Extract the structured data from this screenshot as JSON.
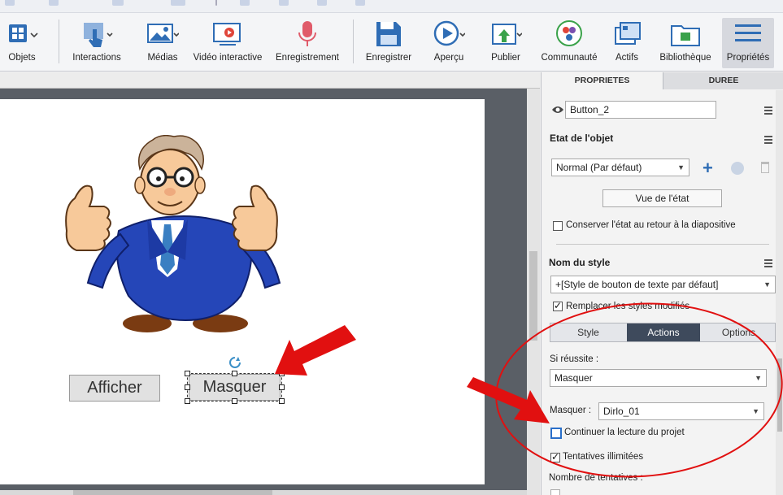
{
  "toolbar": {
    "items": [
      {
        "label": "Objets",
        "icon": "objects-grid-icon"
      },
      {
        "label": "Interactions",
        "icon": "hand-pointer-icon"
      },
      {
        "label": "Médias",
        "icon": "image-icon"
      },
      {
        "label": "Vidéo interactive",
        "icon": "interactive-video-icon"
      },
      {
        "label": "Enregistrement",
        "icon": "microphone-icon"
      },
      {
        "label": "Enregistrer",
        "icon": "save-disk-icon"
      },
      {
        "label": "Aperçu",
        "icon": "play-preview-icon"
      },
      {
        "label": "Publier",
        "icon": "publish-icon"
      },
      {
        "label": "Communauté",
        "icon": "community-icon"
      },
      {
        "label": "Actifs",
        "icon": "assets-icon"
      },
      {
        "label": "Bibliothèque",
        "icon": "library-folder-icon"
      },
      {
        "label": "Propriétés",
        "icon": "properties-list-icon"
      }
    ]
  },
  "stage": {
    "button_show": "Afficher",
    "button_hide": "Masquer"
  },
  "panel": {
    "tab_properties": "PROPRIETES",
    "tab_duration": "DUREE",
    "object_name": "Button_2",
    "state_heading": "Etat de l'objet",
    "state_value": "Normal (Par défaut)",
    "state_view_button": "Vue de l'état",
    "keep_state_label": "Conserver l'état au retour à la diapositive",
    "style_heading": "Nom du style",
    "style_value": "+[Style de bouton de texte par défaut]",
    "replace_styles_label": "Remplacer les styles modifiés",
    "seg_style": "Style",
    "seg_actions": "Actions",
    "seg_options": "Options",
    "success_label": "Si réussite :",
    "success_value": "Masquer",
    "hide_label": "Masquer :",
    "hide_value": "Dirlo_01",
    "continue_label": "Continuer la lecture du projet",
    "unlimited_label": "Tentatives illimitées",
    "attempts_label": "Nombre de tentatives :"
  },
  "colors": {
    "annotation_red": "#e11010",
    "toolbar_bg": "#f4f5f7",
    "selected_segment": "#3e4a5c"
  }
}
